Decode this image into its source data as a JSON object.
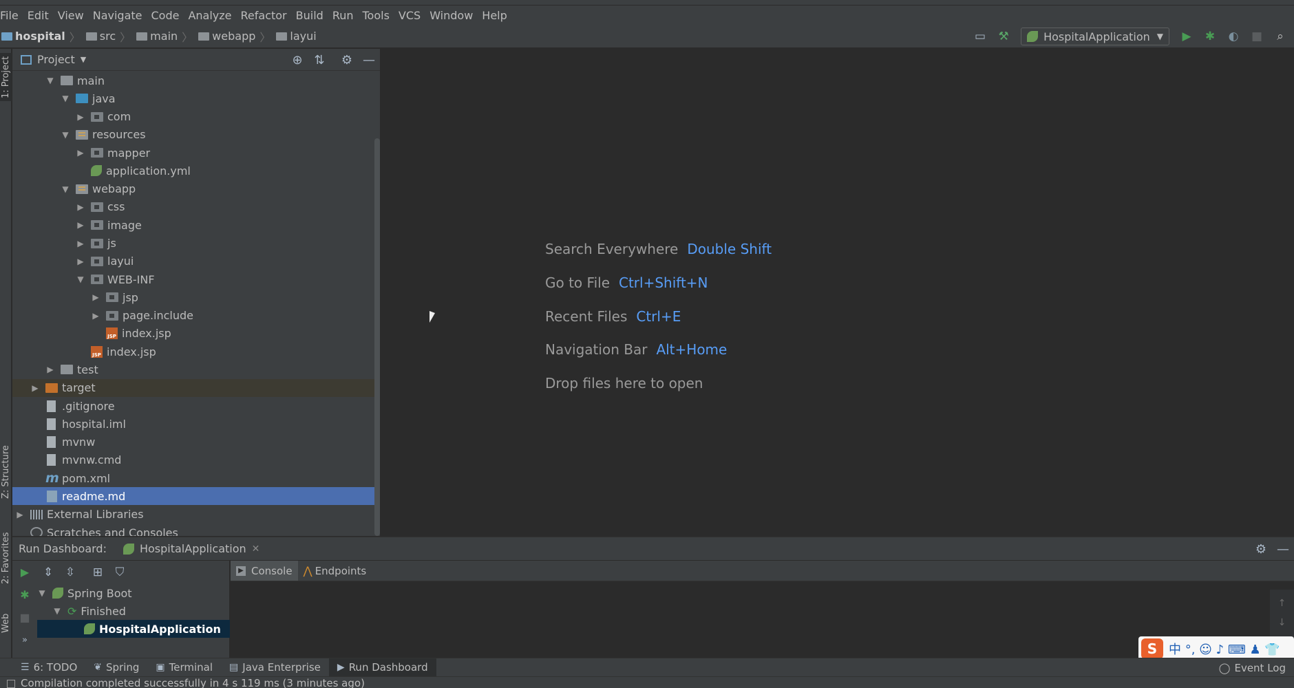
{
  "menu": [
    "File",
    "Edit",
    "View",
    "Navigate",
    "Code",
    "Analyze",
    "Refactor",
    "Build",
    "Run",
    "Tools",
    "VCS",
    "Window",
    "Help"
  ],
  "breadcrumb": {
    "project": "hospital",
    "items": [
      "src",
      "main",
      "webapp",
      "layui"
    ]
  },
  "run_config": "HospitalApplication",
  "left_tabs": {
    "project": "1: Project",
    "structure": "Z: Structure",
    "favorites": "2: Favorites",
    "web": "Web"
  },
  "project_panel": {
    "title": "Project",
    "tree": [
      {
        "label": "main",
        "depth": 2,
        "arrow": "down",
        "icon": "folder"
      },
      {
        "label": "java",
        "depth": 3,
        "arrow": "down",
        "icon": "folder-blue"
      },
      {
        "label": "com",
        "depth": 4,
        "arrow": "right",
        "icon": "package"
      },
      {
        "label": "resources",
        "depth": 3,
        "arrow": "down",
        "icon": "resources"
      },
      {
        "label": "mapper",
        "depth": 4,
        "arrow": "right",
        "icon": "package"
      },
      {
        "label": "application.yml",
        "depth": 4,
        "arrow": "none",
        "icon": "yml"
      },
      {
        "label": "webapp",
        "depth": 3,
        "arrow": "down",
        "icon": "resources"
      },
      {
        "label": "css",
        "depth": 4,
        "arrow": "right",
        "icon": "package"
      },
      {
        "label": "image",
        "depth": 4,
        "arrow": "right",
        "icon": "package"
      },
      {
        "label": "js",
        "depth": 4,
        "arrow": "right",
        "icon": "package"
      },
      {
        "label": "layui",
        "depth": 4,
        "arrow": "right",
        "icon": "package"
      },
      {
        "label": "WEB-INF",
        "depth": 4,
        "arrow": "down",
        "icon": "package"
      },
      {
        "label": "jsp",
        "depth": 5,
        "arrow": "right",
        "icon": "package"
      },
      {
        "label": "page.include",
        "depth": 5,
        "arrow": "right",
        "icon": "package"
      },
      {
        "label": "index.jsp",
        "depth": 5,
        "arrow": "none",
        "icon": "jsp"
      },
      {
        "label": "index.jsp",
        "depth": 4,
        "arrow": "none",
        "icon": "jsp"
      },
      {
        "label": "test",
        "depth": 2,
        "arrow": "right",
        "icon": "folder"
      },
      {
        "label": "target",
        "depth": 1,
        "arrow": "right",
        "icon": "folder-orange"
      },
      {
        "label": ".gitignore",
        "depth": 1,
        "arrow": "none",
        "icon": "file"
      },
      {
        "label": "hospital.iml",
        "depth": 1,
        "arrow": "none",
        "icon": "file"
      },
      {
        "label": "mvnw",
        "depth": 1,
        "arrow": "none",
        "icon": "file"
      },
      {
        "label": "mvnw.cmd",
        "depth": 1,
        "arrow": "none",
        "icon": "file"
      },
      {
        "label": "pom.xml",
        "depth": 1,
        "arrow": "none",
        "icon": "maven"
      },
      {
        "label": "readme.md",
        "depth": 1,
        "arrow": "none",
        "icon": "markdown"
      },
      {
        "label": "External Libraries",
        "depth": 0,
        "arrow": "right",
        "icon": "libraries"
      },
      {
        "label": "Scratches and Consoles",
        "depth": 0,
        "arrow": "none",
        "icon": "scratches"
      }
    ],
    "selected": "readme.md"
  },
  "editor_hints": [
    {
      "label": "Search Everywhere",
      "key": "Double Shift"
    },
    {
      "label": "Go to File",
      "key": "Ctrl+Shift+N"
    },
    {
      "label": "Recent Files",
      "key": "Ctrl+E"
    },
    {
      "label": "Navigation Bar",
      "key": "Alt+Home"
    },
    {
      "label": "Drop files here to open",
      "key": ""
    }
  ],
  "run_dashboard": {
    "title": "Run Dashboard:",
    "tab": "HospitalApplication",
    "tree": {
      "group": "Spring Boot",
      "status": "Finished",
      "app": "HospitalApplication"
    },
    "console_tabs": [
      "Console",
      "Endpoints"
    ]
  },
  "ime": {
    "text": "中 °, ☺ ♪ ⌨ ♟ 👕"
  },
  "bottom_tabs": [
    {
      "label": "6: TODO",
      "icon": "☰"
    },
    {
      "label": "Spring",
      "icon": "❦"
    },
    {
      "label": "Terminal",
      "icon": "▣"
    },
    {
      "label": "Java Enterprise",
      "icon": "▤"
    },
    {
      "label": "Run Dashboard",
      "icon": "▶"
    }
  ],
  "event_log": "Event Log",
  "status": "Compilation completed successfully in 4 s 119 ms (3 minutes ago)"
}
